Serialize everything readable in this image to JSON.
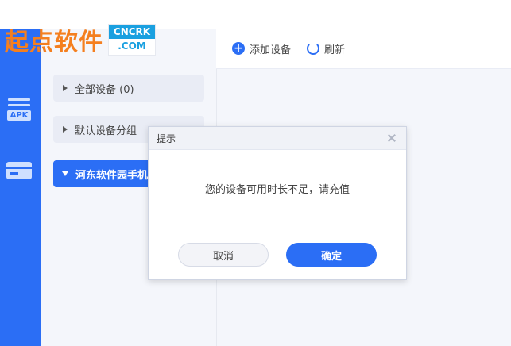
{
  "logo": {
    "text": "起点软件",
    "box_top": "CNCRK",
    "box_bottom": ".COM"
  },
  "toolbar": {
    "add_label": "添加设备",
    "refresh_label": "刷新"
  },
  "sidebar": {
    "rail": {
      "apk_label": "APK"
    },
    "groups": [
      {
        "label": "全部设备 (0)"
      },
      {
        "label": "默认设备分组"
      },
      {
        "label": "河东软件园手机"
      }
    ]
  },
  "dialog": {
    "title": "提示",
    "message": "您的设备可用时长不足，请充值",
    "cancel_label": "取消",
    "ok_label": "确定"
  },
  "colors": {
    "accent": "#2b6ef5",
    "brand_orange": "#f47f1f",
    "brand_blue": "#1aa0e0"
  }
}
